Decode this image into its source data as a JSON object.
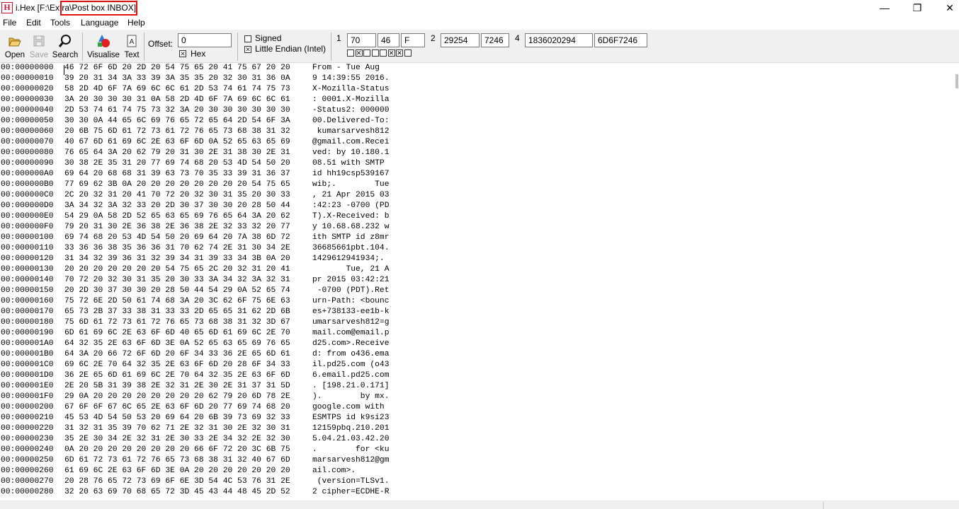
{
  "window": {
    "app_icon": "H",
    "title": "i.Hex [F:\\Extra\\Post box INBOX]",
    "min_glyph": "—",
    "max_glyph": "❐",
    "close_glyph": "✕"
  },
  "menu": {
    "items": [
      "File",
      "Edit",
      "Tools",
      "Language",
      "Help"
    ]
  },
  "toolbar": {
    "open_label": "Open",
    "save_label": "Save",
    "search_label": "Search",
    "visualise_label": "Visualise",
    "text_label": "Text",
    "offset_label": "Offset:",
    "offset_value": "0",
    "hex_label": "Hex",
    "hex_checked": true,
    "signed_label": "Signed",
    "signed_checked": false,
    "endian_label": "Little Endian (Intel)",
    "endian_checked": true,
    "num1_label": "1",
    "num1_values": [
      "70",
      "46",
      "F"
    ],
    "num2_label": "2",
    "num2_values": [
      "29254",
      "7246"
    ],
    "num4_label": "4",
    "num4_values": [
      "1836020294",
      "6D6F7246"
    ],
    "bits": [
      false,
      true,
      false,
      false,
      false,
      true,
      true,
      false
    ]
  },
  "hex_rows": [
    {
      "addr": "00:00000000",
      "hex": "46 72 6F 6D 20 2D 20 54 75 65 20 41 75 67 20 20",
      "text": "From - Tue Aug  "
    },
    {
      "addr": "00:00000010",
      "hex": "39 20 31 34 3A 33 39 3A 35 35 20 32 30 31 36 0A",
      "text": "9 14:39:55 2016."
    },
    {
      "addr": "00:00000020",
      "hex": "58 2D 4D 6F 7A 69 6C 6C 61 2D 53 74 61 74 75 73",
      "text": "X-Mozilla-Status"
    },
    {
      "addr": "00:00000030",
      "hex": "3A 20 30 30 30 31 0A 58 2D 4D 6F 7A 69 6C 6C 61",
      "text": ": 0001.X-Mozilla"
    },
    {
      "addr": "00:00000040",
      "hex": "2D 53 74 61 74 75 73 32 3A 20 30 30 30 30 30 30",
      "text": "-Status2: 000000"
    },
    {
      "addr": "00:00000050",
      "hex": "30 30 0A 44 65 6C 69 76 65 72 65 64 2D 54 6F 3A",
      "text": "00.Delivered-To:"
    },
    {
      "addr": "00:00000060",
      "hex": "20 6B 75 6D 61 72 73 61 72 76 65 73 68 38 31 32",
      "text": " kumarsarvesh812"
    },
    {
      "addr": "00:00000070",
      "hex": "40 67 6D 61 69 6C 2E 63 6F 6D 0A 52 65 63 65 69",
      "text": "@gmail.com.Recei"
    },
    {
      "addr": "00:00000080",
      "hex": "76 65 64 3A 20 62 79 20 31 30 2E 31 38 30 2E 31",
      "text": "ved: by 10.180.1"
    },
    {
      "addr": "00:00000090",
      "hex": "30 38 2E 35 31 20 77 69 74 68 20 53 4D 54 50 20",
      "text": "08.51 with SMTP "
    },
    {
      "addr": "00:000000A0",
      "hex": "69 64 20 68 68 31 39 63 73 70 35 33 39 31 36 37",
      "text": "id hh19csp539167"
    },
    {
      "addr": "00:000000B0",
      "hex": "77 69 62 3B 0A 20 20 20 20 20 20 20 20 54 75 65",
      "text": "wib;.        Tue"
    },
    {
      "addr": "00:000000C0",
      "hex": "2C 20 32 31 20 41 70 72 20 32 30 31 35 20 30 33",
      "text": ", 21 Apr 2015 03"
    },
    {
      "addr": "00:000000D0",
      "hex": "3A 34 32 3A 32 33 20 2D 30 37 30 30 20 28 50 44",
      "text": ":42:23 -0700 (PD"
    },
    {
      "addr": "00:000000E0",
      "hex": "54 29 0A 58 2D 52 65 63 65 69 76 65 64 3A 20 62",
      "text": "T).X-Received: b"
    },
    {
      "addr": "00:000000F0",
      "hex": "79 20 31 30 2E 36 38 2E 36 38 2E 32 33 32 20 77",
      "text": "y 10.68.68.232 w"
    },
    {
      "addr": "00:00000100",
      "hex": "69 74 68 20 53 4D 54 50 20 69 64 20 7A 38 6D 72",
      "text": "ith SMTP id z8mr"
    },
    {
      "addr": "00:00000110",
      "hex": "33 36 36 38 35 36 36 31 70 62 74 2E 31 30 34 2E",
      "text": "36685661pbt.104."
    },
    {
      "addr": "00:00000120",
      "hex": "31 34 32 39 36 31 32 39 34 31 39 33 34 3B 0A 20",
      "text": "1429612941934;. "
    },
    {
      "addr": "00:00000130",
      "hex": "20 20 20 20 20 20 20 54 75 65 2C 20 32 31 20 41",
      "text": "       Tue, 21 A"
    },
    {
      "addr": "00:00000140",
      "hex": "70 72 20 32 30 31 35 20 30 33 3A 34 32 3A 32 31",
      "text": "pr 2015 03:42:21"
    },
    {
      "addr": "00:00000150",
      "hex": "20 2D 30 37 30 30 20 28 50 44 54 29 0A 52 65 74",
      "text": " -0700 (PDT).Ret"
    },
    {
      "addr": "00:00000160",
      "hex": "75 72 6E 2D 50 61 74 68 3A 20 3C 62 6F 75 6E 63",
      "text": "urn-Path: <bounc"
    },
    {
      "addr": "00:00000170",
      "hex": "65 73 2B 37 33 38 31 33 33 2D 65 65 31 62 2D 6B",
      "text": "es+738133-ee1b-k"
    },
    {
      "addr": "00:00000180",
      "hex": "75 6D 61 72 73 61 72 76 65 73 68 38 31 32 3D 67",
      "text": "umarsarvesh812=g"
    },
    {
      "addr": "00:00000190",
      "hex": "6D 61 69 6C 2E 63 6F 6D 40 65 6D 61 69 6C 2E 70",
      "text": "mail.com@email.p"
    },
    {
      "addr": "00:000001A0",
      "hex": "64 32 35 2E 63 6F 6D 3E 0A 52 65 63 65 69 76 65",
      "text": "d25.com>.Receive"
    },
    {
      "addr": "00:000001B0",
      "hex": "64 3A 20 66 72 6F 6D 20 6F 34 33 36 2E 65 6D 61",
      "text": "d: from o436.ema"
    },
    {
      "addr": "00:000001C0",
      "hex": "69 6C 2E 70 64 32 35 2E 63 6F 6D 20 28 6F 34 33",
      "text": "il.pd25.com (o43"
    },
    {
      "addr": "00:000001D0",
      "hex": "36 2E 65 6D 61 69 6C 2E 70 64 32 35 2E 63 6F 6D",
      "text": "6.email.pd25.com"
    },
    {
      "addr": "00:000001E0",
      "hex": "2E 20 5B 31 39 38 2E 32 31 2E 30 2E 31 37 31 5D",
      "text": ". [198.21.0.171]"
    },
    {
      "addr": "00:000001F0",
      "hex": "29 0A 20 20 20 20 20 20 20 20 62 79 20 6D 78 2E",
      "text": ").        by mx."
    },
    {
      "addr": "00:00000200",
      "hex": "67 6F 6F 67 6C 65 2E 63 6F 6D 20 77 69 74 68 20",
      "text": "google.com with "
    },
    {
      "addr": "00:00000210",
      "hex": "45 53 4D 54 50 53 20 69 64 20 6B 39 73 69 32 33",
      "text": "ESMTPS id k9si23"
    },
    {
      "addr": "00:00000220",
      "hex": "31 32 31 35 39 70 62 71 2E 32 31 30 2E 32 30 31",
      "text": "12159pbq.210.201"
    },
    {
      "addr": "00:00000230",
      "hex": "35 2E 30 34 2E 32 31 2E 30 33 2E 34 32 2E 32 30",
      "text": "5.04.21.03.42.20"
    },
    {
      "addr": "00:00000240",
      "hex": "0A 20 20 20 20 20 20 20 20 66 6F 72 20 3C 6B 75",
      "text": ".        for <ku"
    },
    {
      "addr": "00:00000250",
      "hex": "6D 61 72 73 61 72 76 65 73 68 38 31 32 40 67 6D",
      "text": "marsarvesh812@gm"
    },
    {
      "addr": "00:00000260",
      "hex": "61 69 6C 2E 63 6F 6D 3E 0A 20 20 20 20 20 20 20",
      "text": "ail.com>.       "
    },
    {
      "addr": "00:00000270",
      "hex": "20 28 76 65 72 73 69 6F 6E 3D 54 4C 53 76 31 2E",
      "text": " (version=TLSv1."
    },
    {
      "addr": "00:00000280",
      "hex": "32 20 63 69 70 68 65 72 3D 45 43 44 48 45 2D 52",
      "text": "2 cipher=ECDHE-R"
    }
  ]
}
